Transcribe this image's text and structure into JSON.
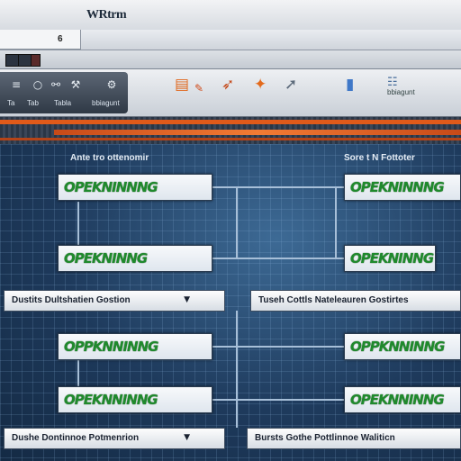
{
  "window": {
    "title": "WRtrm",
    "tab_label": "6"
  },
  "toolbar": {
    "nav_labels": [
      "Ta",
      "Tab",
      "Tabla"
    ],
    "right_label": "bbiagunt"
  },
  "workspace": {
    "left_header": "Ante tro ottenomir",
    "right_header": "Sore t N Fottoter",
    "nodes_left": [
      "OPEKNINNNG",
      "OPEKNINNG",
      "OPPKNNINNG",
      "OPEKNNINNG"
    ],
    "nodes_right": [
      "OPEKNINNNG",
      "OPEKNINNG",
      "OPPKNNINNG",
      "OPEKNNINNG"
    ],
    "mid_bar_left": "Dustits Dultshatien Gostion",
    "mid_bar_right": "Tuseh Cottls Nateleauren Gostirtes",
    "bottom_bar_left": "Dushe Dontinnoe Potmenrion",
    "bottom_bar_right": "Bursts Gothe Pottlinnoe Waliticn"
  },
  "colors": {
    "banner_orange": "#e05a1a",
    "node_text_green": "#1f8a2c",
    "workspace_blue": "#1e3a5c"
  }
}
